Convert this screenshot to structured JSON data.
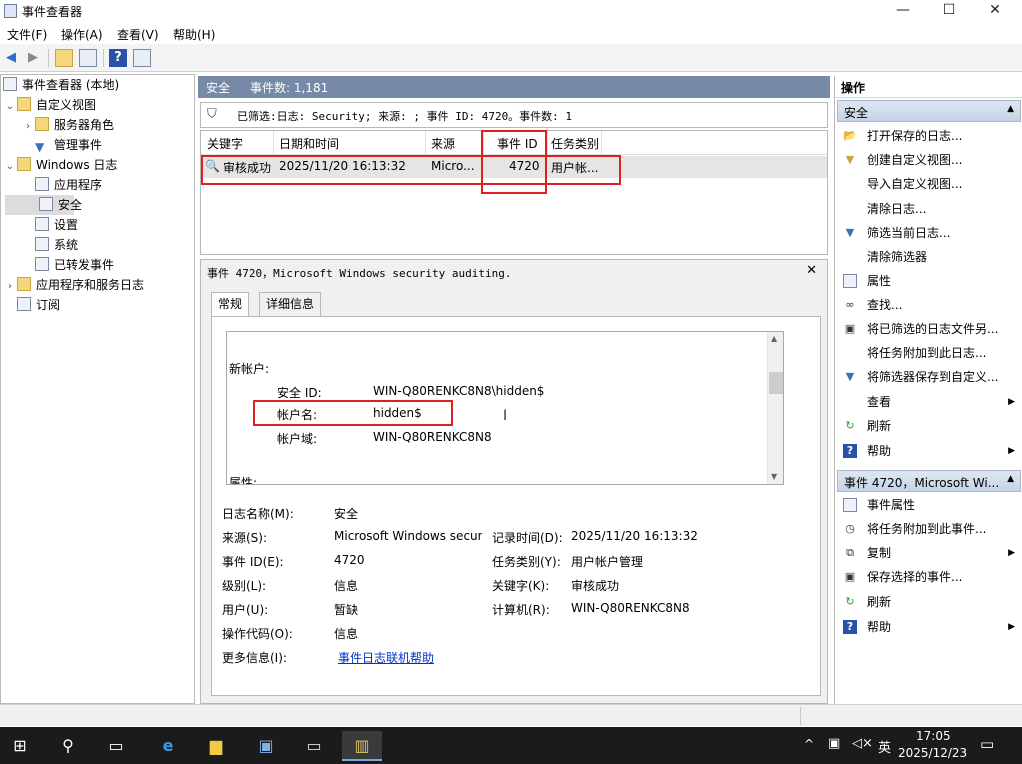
{
  "window": {
    "title": "事件查看器",
    "min": "—",
    "max": "☐",
    "close": "✕"
  },
  "menu": [
    "文件(F)",
    "操作(A)",
    "查看(V)",
    "帮助(H)"
  ],
  "tree": {
    "root": "事件查看器 (本地)",
    "custom_views": "自定义视图",
    "server_roles": "服务器角色",
    "admin_events": "管理事件",
    "windows_logs": "Windows 日志",
    "application": "应用程序",
    "security": "安全",
    "setup": "设置",
    "system": "系统",
    "forwarded": "已转发事件",
    "app_service_logs": "应用程序和服务日志",
    "subscriptions": "订阅"
  },
  "center": {
    "log_name": "安全",
    "event_count": "事件数: 1,181",
    "filter_text": "已筛选:日志: Security; 来源: ; 事件 ID: 4720。事件数: 1",
    "columns": [
      "关键字",
      "日期和时间",
      "来源",
      "事件 ID",
      "任务类别"
    ],
    "row": {
      "keyword": "审核成功",
      "datetime": "2025/11/20 16:13:32",
      "source": "Micro...",
      "event_id": "4720",
      "category": "用户帐..."
    }
  },
  "detail": {
    "title": "事件 4720，Microsoft Windows security auditing.",
    "tab_general": "常规",
    "tab_details": "详细信息",
    "message": {
      "new_account": "新帐户:",
      "sid_label": "安全 ID:",
      "sid_value": "WIN-Q80RENKC8N8\\hidden$",
      "account_label": "帐户名:",
      "account_value": "hidden$",
      "domain_label": "帐户域:",
      "domain_value": "WIN-Q80RENKC8N8",
      "attributes": "属性:"
    },
    "fields": {
      "log_name_label": "日志名称(M):",
      "log_name_value": "安全",
      "source_label": "来源(S):",
      "source_value": "Microsoft Windows secur",
      "logged_label": "记录时间(D):",
      "logged_value": "2025/11/20 16:13:32",
      "event_id_label": "事件 ID(E):",
      "event_id_value": "4720",
      "task_label": "任务类别(Y):",
      "task_value": "用户帐户管理",
      "level_label": "级别(L):",
      "level_value": "信息",
      "keywords_label": "关键字(K):",
      "keywords_value": "审核成功",
      "user_label": "用户(U):",
      "user_value": "暂缺",
      "computer_label": "计算机(R):",
      "computer_value": "WIN-Q80RENKC8N8",
      "opcode_label": "操作代码(O):",
      "opcode_value": "信息",
      "more_label": "更多信息(I):",
      "more_link": "事件日志联机帮助"
    }
  },
  "actions": {
    "title": "操作",
    "section1": "安全",
    "items1": [
      "打开保存的日志...",
      "创建自定义视图...",
      "导入自定义视图...",
      "清除日志...",
      "筛选当前日志...",
      "清除筛选器",
      "属性",
      "查找...",
      "将已筛选的日志文件另...",
      "将任务附加到此日志...",
      "将筛选器保存到自定义...",
      "查看",
      "刷新",
      "帮助"
    ],
    "section2": "事件 4720，Microsoft Wi...",
    "items2": [
      "事件属性",
      "将任务附加到此事件...",
      "复制",
      "保存选择的事件...",
      "刷新",
      "帮助"
    ]
  },
  "taskbar": {
    "time": "17:05",
    "date": "2025/12/23",
    "ime": "英"
  }
}
